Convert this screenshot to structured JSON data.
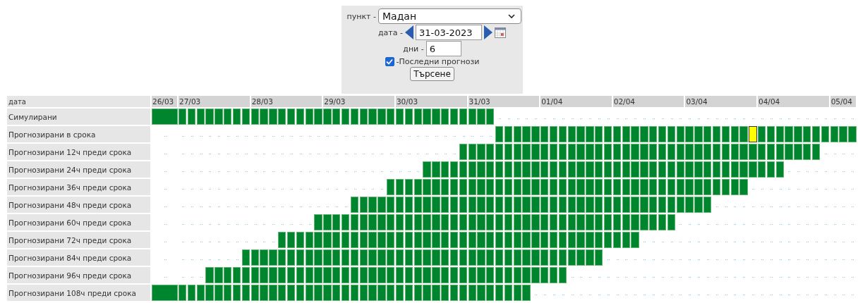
{
  "form": {
    "station": {
      "label": "пункт -",
      "value": "Мадан"
    },
    "date": {
      "label": "дата -",
      "value": "31-03-2023"
    },
    "days": {
      "label": "дни -",
      "value": "6"
    },
    "latest": {
      "label": "-Последни прогнози",
      "checked": true
    },
    "button": "Търсене"
  },
  "table": {
    "corner": "дата",
    "dates": [
      "26/03",
      "27/03",
      "28/03",
      "29/03",
      "30/03",
      "31/03",
      "01/04",
      "02/04",
      "03/04",
      "04/04",
      "05/04"
    ],
    "rows": [
      {
        "label": "Симулирани",
        "cells": [
          true,
          true,
          true,
          true,
          true,
          true,
          true,
          true,
          true,
          true,
          true,
          true,
          true,
          true,
          true,
          true,
          true,
          true,
          true,
          true,
          true,
          true,
          true,
          true,
          true,
          true,
          true,
          true,
          true,
          true,
          true,
          true,
          true,
          true,
          true,
          true,
          false,
          false,
          false,
          false,
          false,
          false,
          false,
          false,
          false,
          false,
          false,
          false,
          false,
          false,
          false,
          false,
          false,
          false,
          false,
          false,
          false,
          false,
          false,
          false,
          false,
          false,
          false,
          false,
          false,
          false,
          false,
          false,
          false,
          false,
          false,
          false,
          false,
          false,
          false,
          false
        ],
        "flagged": [
          false,
          false,
          false,
          false,
          false,
          false,
          false,
          false,
          false,
          false,
          false,
          false,
          false,
          false,
          false,
          false,
          false,
          false,
          false,
          false,
          false,
          false,
          false,
          false,
          false,
          false,
          false,
          false,
          false,
          false,
          false,
          false,
          false,
          false,
          false,
          false,
          false,
          false,
          false,
          false,
          false,
          false,
          false,
          false,
          false,
          false,
          false,
          false,
          false,
          false,
          false,
          false,
          false,
          false,
          false,
          false,
          false,
          false,
          false,
          false,
          false,
          false,
          false,
          false,
          false,
          false,
          false,
          false,
          false,
          false,
          false,
          false,
          false,
          false,
          false,
          false
        ]
      },
      {
        "label": "Прогнозирани в срока",
        "cells": [
          false,
          false,
          false,
          false,
          false,
          false,
          false,
          false,
          false,
          false,
          false,
          false,
          false,
          false,
          false,
          false,
          false,
          false,
          false,
          false,
          false,
          false,
          false,
          false,
          false,
          false,
          false,
          false,
          false,
          false,
          false,
          false,
          false,
          false,
          false,
          false,
          true,
          true,
          true,
          true,
          true,
          true,
          true,
          true,
          true,
          true,
          true,
          true,
          true,
          true,
          true,
          true,
          true,
          true,
          true,
          true,
          true,
          true,
          true,
          true,
          true,
          true,
          true,
          true,
          true,
          true,
          true,
          true,
          true,
          true,
          true,
          true,
          true,
          true,
          true,
          true
        ],
        "flagged": [
          false,
          false,
          false,
          false,
          false,
          false,
          false,
          false,
          false,
          false,
          false,
          false,
          false,
          false,
          false,
          false,
          false,
          false,
          false,
          false,
          false,
          false,
          false,
          false,
          false,
          false,
          false,
          false,
          false,
          false,
          false,
          false,
          false,
          false,
          false,
          false,
          false,
          false,
          false,
          false,
          false,
          false,
          false,
          false,
          false,
          false,
          false,
          false,
          false,
          false,
          false,
          false,
          false,
          false,
          false,
          false,
          false,
          false,
          false,
          false,
          false,
          false,
          false,
          false,
          true,
          false,
          false,
          false,
          false,
          false,
          false,
          false,
          false,
          false,
          false,
          false
        ]
      },
      {
        "label": "Прогнозирани 12ч преди срока",
        "cells": [
          false,
          false,
          false,
          false,
          false,
          false,
          false,
          false,
          false,
          false,
          false,
          false,
          false,
          false,
          false,
          false,
          false,
          false,
          false,
          false,
          false,
          false,
          false,
          false,
          false,
          false,
          false,
          false,
          false,
          false,
          false,
          false,
          true,
          true,
          true,
          true,
          true,
          true,
          true,
          true,
          true,
          true,
          true,
          true,
          true,
          true,
          true,
          true,
          true,
          true,
          true,
          true,
          true,
          true,
          true,
          true,
          true,
          true,
          true,
          true,
          true,
          true,
          true,
          true,
          true,
          true,
          true,
          true,
          true,
          true,
          true,
          true,
          false,
          false,
          false,
          false
        ],
        "flagged": [
          false,
          false,
          false,
          false,
          false,
          false,
          false,
          false,
          false,
          false,
          false,
          false,
          false,
          false,
          false,
          false,
          false,
          false,
          false,
          false,
          false,
          false,
          false,
          false,
          false,
          false,
          false,
          false,
          false,
          false,
          false,
          false,
          false,
          false,
          false,
          false,
          false,
          false,
          false,
          false,
          false,
          false,
          false,
          false,
          false,
          false,
          false,
          false,
          false,
          false,
          false,
          false,
          false,
          false,
          false,
          false,
          false,
          false,
          false,
          false,
          false,
          false,
          false,
          false,
          false,
          false,
          false,
          false,
          false,
          false,
          false,
          false,
          false,
          false,
          false,
          false
        ]
      },
      {
        "label": "Прогнозирани 24ч преди срока",
        "cells": [
          false,
          false,
          false,
          false,
          false,
          false,
          false,
          false,
          false,
          false,
          false,
          false,
          false,
          false,
          false,
          false,
          false,
          false,
          false,
          false,
          false,
          false,
          false,
          false,
          false,
          false,
          false,
          false,
          true,
          true,
          true,
          true,
          true,
          true,
          true,
          true,
          true,
          true,
          true,
          true,
          true,
          true,
          true,
          true,
          true,
          true,
          true,
          true,
          true,
          true,
          true,
          true,
          true,
          true,
          true,
          true,
          true,
          true,
          true,
          true,
          true,
          true,
          true,
          true,
          true,
          true,
          true,
          true,
          false,
          false,
          false,
          false,
          false,
          false,
          false,
          false
        ],
        "flagged": [
          false,
          false,
          false,
          false,
          false,
          false,
          false,
          false,
          false,
          false,
          false,
          false,
          false,
          false,
          false,
          false,
          false,
          false,
          false,
          false,
          false,
          false,
          false,
          false,
          false,
          false,
          false,
          false,
          false,
          false,
          false,
          false,
          false,
          false,
          false,
          false,
          false,
          false,
          false,
          false,
          false,
          false,
          false,
          false,
          false,
          false,
          false,
          false,
          false,
          false,
          false,
          false,
          false,
          false,
          false,
          false,
          false,
          false,
          false,
          false,
          false,
          false,
          false,
          false,
          false,
          false,
          false,
          false,
          false,
          false,
          false,
          false,
          false,
          false,
          false,
          false
        ]
      },
      {
        "label": "Прогнозирани 36ч преди срока",
        "cells": [
          false,
          false,
          false,
          false,
          false,
          false,
          false,
          false,
          false,
          false,
          false,
          false,
          false,
          false,
          false,
          false,
          false,
          false,
          false,
          false,
          false,
          false,
          false,
          false,
          true,
          true,
          true,
          true,
          true,
          true,
          true,
          true,
          true,
          true,
          true,
          true,
          true,
          true,
          true,
          true,
          true,
          true,
          true,
          true,
          true,
          true,
          true,
          true,
          true,
          true,
          true,
          true,
          true,
          true,
          true,
          true,
          true,
          true,
          true,
          true,
          true,
          true,
          true,
          true,
          false,
          false,
          false,
          false,
          false,
          false,
          false,
          false,
          false,
          false,
          false,
          false
        ],
        "flagged": [
          false,
          false,
          false,
          false,
          false,
          false,
          false,
          false,
          false,
          false,
          false,
          false,
          false,
          false,
          false,
          false,
          false,
          false,
          false,
          false,
          false,
          false,
          false,
          false,
          false,
          false,
          false,
          false,
          false,
          false,
          false,
          false,
          false,
          false,
          false,
          false,
          false,
          false,
          false,
          false,
          false,
          false,
          false,
          false,
          false,
          false,
          false,
          false,
          false,
          false,
          false,
          false,
          false,
          false,
          false,
          false,
          false,
          false,
          false,
          false,
          false,
          false,
          false,
          false,
          false,
          false,
          false,
          false,
          false,
          false,
          false,
          false,
          false,
          false,
          false,
          false
        ]
      },
      {
        "label": "Прогнозирани 48ч преди срока",
        "cells": [
          false,
          false,
          false,
          false,
          false,
          false,
          false,
          false,
          false,
          false,
          false,
          false,
          false,
          false,
          false,
          false,
          false,
          false,
          false,
          false,
          true,
          true,
          true,
          true,
          true,
          true,
          true,
          true,
          true,
          true,
          true,
          true,
          true,
          true,
          true,
          true,
          true,
          true,
          true,
          true,
          true,
          true,
          true,
          true,
          true,
          true,
          true,
          true,
          true,
          true,
          true,
          true,
          true,
          true,
          true,
          true,
          true,
          true,
          true,
          true,
          false,
          false,
          false,
          false,
          false,
          false,
          false,
          false,
          false,
          false,
          false,
          false,
          false,
          false,
          false,
          false
        ],
        "flagged": [
          false,
          false,
          false,
          false,
          false,
          false,
          false,
          false,
          false,
          false,
          false,
          false,
          false,
          false,
          false,
          false,
          false,
          false,
          false,
          false,
          false,
          false,
          false,
          false,
          false,
          false,
          false,
          false,
          false,
          false,
          false,
          false,
          false,
          false,
          false,
          false,
          false,
          false,
          false,
          false,
          false,
          false,
          false,
          false,
          false,
          false,
          false,
          false,
          false,
          false,
          false,
          false,
          false,
          false,
          false,
          false,
          false,
          false,
          false,
          false,
          false,
          false,
          false,
          false,
          false,
          false,
          false,
          false,
          false,
          false,
          false,
          false,
          false,
          false,
          false,
          false
        ]
      },
      {
        "label": "Прогнозирани 60ч преди срока",
        "cells": [
          false,
          false,
          false,
          false,
          false,
          false,
          false,
          false,
          false,
          false,
          false,
          false,
          false,
          false,
          false,
          false,
          true,
          true,
          true,
          true,
          true,
          true,
          true,
          true,
          true,
          true,
          true,
          true,
          true,
          true,
          true,
          true,
          true,
          true,
          true,
          true,
          true,
          true,
          true,
          true,
          true,
          true,
          true,
          true,
          true,
          true,
          true,
          true,
          true,
          true,
          true,
          true,
          true,
          true,
          true,
          true,
          false,
          false,
          false,
          false,
          false,
          false,
          false,
          false,
          false,
          false,
          false,
          false,
          false,
          false,
          false,
          false,
          false,
          false,
          false,
          false
        ],
        "flagged": [
          false,
          false,
          false,
          false,
          false,
          false,
          false,
          false,
          false,
          false,
          false,
          false,
          false,
          false,
          false,
          false,
          false,
          false,
          false,
          false,
          false,
          false,
          false,
          false,
          false,
          false,
          false,
          false,
          false,
          false,
          false,
          false,
          false,
          false,
          false,
          false,
          false,
          false,
          false,
          false,
          false,
          false,
          false,
          false,
          false,
          false,
          false,
          false,
          false,
          false,
          false,
          false,
          false,
          false,
          false,
          false,
          false,
          false,
          false,
          false,
          false,
          false,
          false,
          false,
          false,
          false,
          false,
          false,
          false,
          false,
          false,
          false,
          false,
          false,
          false,
          false
        ]
      },
      {
        "label": "Прогнозирани 72ч преди срока",
        "cells": [
          false,
          false,
          false,
          false,
          false,
          false,
          false,
          false,
          false,
          false,
          false,
          false,
          true,
          true,
          true,
          true,
          true,
          true,
          true,
          true,
          true,
          true,
          true,
          true,
          true,
          true,
          true,
          true,
          true,
          true,
          true,
          true,
          true,
          true,
          true,
          true,
          true,
          true,
          true,
          true,
          true,
          true,
          true,
          true,
          true,
          true,
          true,
          true,
          true,
          true,
          true,
          true,
          false,
          false,
          false,
          false,
          false,
          false,
          false,
          false,
          false,
          false,
          false,
          false,
          false,
          false,
          false,
          false,
          false,
          false,
          false,
          false,
          false,
          false,
          false,
          false
        ],
        "flagged": [
          false,
          false,
          false,
          false,
          false,
          false,
          false,
          false,
          false,
          false,
          false,
          false,
          false,
          false,
          false,
          false,
          false,
          false,
          false,
          false,
          false,
          false,
          false,
          false,
          false,
          false,
          false,
          false,
          false,
          false,
          false,
          false,
          false,
          false,
          false,
          false,
          false,
          false,
          false,
          false,
          false,
          false,
          false,
          false,
          false,
          false,
          false,
          false,
          false,
          false,
          false,
          false,
          false,
          false,
          false,
          false,
          false,
          false,
          false,
          false,
          false,
          false,
          false,
          false,
          false,
          false,
          false,
          false,
          false,
          false,
          false,
          false,
          false,
          false,
          false,
          false
        ]
      },
      {
        "label": "Прогнозирани 84ч преди срока",
        "cells": [
          false,
          false,
          false,
          false,
          false,
          false,
          false,
          false,
          true,
          true,
          true,
          true,
          true,
          true,
          true,
          true,
          true,
          true,
          true,
          true,
          true,
          true,
          true,
          true,
          true,
          true,
          true,
          true,
          true,
          true,
          true,
          true,
          true,
          true,
          true,
          true,
          true,
          true,
          true,
          true,
          true,
          true,
          true,
          true,
          true,
          true,
          true,
          true,
          false,
          false,
          false,
          false,
          false,
          false,
          false,
          false,
          false,
          false,
          false,
          false,
          false,
          false,
          false,
          false,
          false,
          false,
          false,
          false,
          false,
          false,
          false,
          false,
          false,
          false,
          false,
          false
        ],
        "flagged": [
          false,
          false,
          false,
          false,
          false,
          false,
          false,
          false,
          false,
          false,
          false,
          false,
          false,
          false,
          false,
          false,
          false,
          false,
          false,
          false,
          false,
          false,
          false,
          false,
          false,
          false,
          false,
          false,
          false,
          false,
          false,
          false,
          false,
          false,
          false,
          false,
          false,
          false,
          false,
          false,
          false,
          false,
          false,
          false,
          false,
          false,
          false,
          false,
          false,
          false,
          false,
          false,
          false,
          false,
          false,
          false,
          false,
          false,
          false,
          false,
          false,
          false,
          false,
          false,
          false,
          false,
          false,
          false,
          false,
          false,
          false,
          false,
          false,
          false,
          false,
          false
        ]
      },
      {
        "label": "Прогнозирани 96ч преди срока",
        "cells": [
          false,
          false,
          false,
          false,
          true,
          true,
          true,
          true,
          true,
          true,
          true,
          true,
          true,
          true,
          true,
          true,
          true,
          true,
          true,
          true,
          true,
          true,
          true,
          true,
          true,
          true,
          true,
          true,
          true,
          true,
          true,
          true,
          true,
          true,
          true,
          true,
          true,
          true,
          true,
          true,
          true,
          true,
          true,
          true,
          false,
          false,
          false,
          false,
          false,
          false,
          false,
          false,
          false,
          false,
          false,
          false,
          false,
          false,
          false,
          false,
          false,
          false,
          false,
          false,
          false,
          false,
          false,
          false,
          false,
          false,
          false,
          false,
          false,
          false,
          false,
          false
        ],
        "flagged": [
          false,
          false,
          false,
          false,
          false,
          false,
          false,
          false,
          false,
          false,
          false,
          false,
          false,
          false,
          false,
          false,
          false,
          false,
          false,
          false,
          false,
          false,
          false,
          false,
          false,
          false,
          false,
          false,
          false,
          false,
          false,
          false,
          false,
          false,
          false,
          false,
          false,
          false,
          false,
          false,
          false,
          false,
          false,
          false,
          false,
          false,
          false,
          false,
          false,
          false,
          false,
          false,
          false,
          false,
          false,
          false,
          false,
          false,
          false,
          false,
          false,
          false,
          false,
          false,
          false,
          false,
          false,
          false,
          false,
          false,
          false,
          false,
          false,
          false,
          false,
          false
        ]
      },
      {
        "label": "Прогнозирани 108ч преди срока",
        "cells": [
          true,
          true,
          true,
          true,
          true,
          true,
          true,
          true,
          true,
          true,
          true,
          true,
          true,
          true,
          true,
          true,
          true,
          true,
          true,
          true,
          true,
          true,
          true,
          true,
          true,
          true,
          true,
          true,
          true,
          true,
          true,
          true,
          true,
          true,
          true,
          true,
          true,
          true,
          true,
          true,
          false,
          false,
          false,
          false,
          false,
          false,
          false,
          false,
          false,
          false,
          false,
          false,
          false,
          false,
          false,
          false,
          false,
          false,
          false,
          false,
          false,
          false,
          false,
          false,
          false,
          false,
          false,
          false,
          false,
          false,
          false,
          false,
          false,
          false,
          false,
          false
        ],
        "flagged": [
          false,
          false,
          false,
          false,
          false,
          false,
          false,
          false,
          false,
          false,
          false,
          false,
          false,
          false,
          false,
          false,
          false,
          false,
          false,
          false,
          false,
          false,
          false,
          false,
          false,
          false,
          false,
          false,
          false,
          false,
          false,
          false,
          false,
          false,
          false,
          false,
          false,
          false,
          false,
          false,
          false,
          false,
          false,
          false,
          false,
          false,
          false,
          false,
          false,
          false,
          false,
          false,
          false,
          false,
          false,
          false,
          false,
          false,
          false,
          false,
          false,
          false,
          false,
          false,
          false,
          false,
          false,
          false,
          false,
          false,
          false,
          false,
          false,
          false,
          false,
          false
        ]
      }
    ]
  }
}
